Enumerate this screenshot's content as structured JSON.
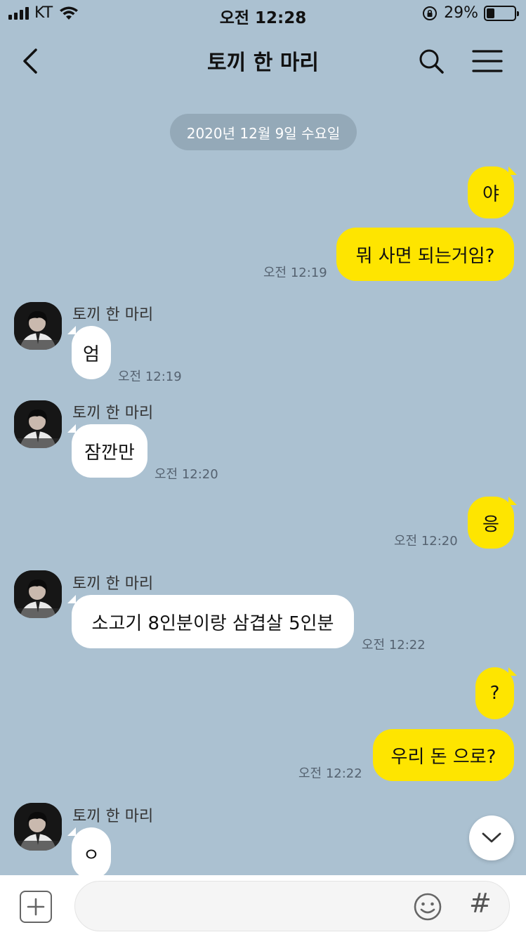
{
  "status_bar": {
    "carrier": "KT",
    "time": "오전 12:28",
    "battery": "29%",
    "battery_level": 0.29
  },
  "header": {
    "title": "토끼 한 마리",
    "back_icon": "chevron-left-icon",
    "search_icon": "search-icon",
    "menu_icon": "hamburger-menu-icon"
  },
  "date_divider": "2020년 12월 9일 수요일",
  "contact_name": "토끼 한 마리",
  "messages": [
    {
      "from": "me",
      "text": "야",
      "time": ""
    },
    {
      "from": "me",
      "text": "뭐 사면 되는거임?",
      "time": "오전 12:19"
    },
    {
      "from": "them",
      "text": "엄",
      "time": "오전 12:19"
    },
    {
      "from": "them",
      "text": "잠깐만",
      "time": "오전 12:20"
    },
    {
      "from": "me",
      "text": "응",
      "time": "오전 12:20"
    },
    {
      "from": "them",
      "text": "소고기 8인분이랑 삼겹살 5인분",
      "time": "오전 12:22"
    },
    {
      "from": "me",
      "text": "?",
      "time": ""
    },
    {
      "from": "me",
      "text": "우리 돈 으로?",
      "time": "오전 12:22"
    },
    {
      "from": "them",
      "text": "ㅇ",
      "time": ""
    }
  ],
  "input": {
    "placeholder": "",
    "value": "",
    "hash_label": "#"
  },
  "colors": {
    "background": "#abc1d1",
    "my_bubble": "#fee500",
    "their_bubble": "#ffffff"
  }
}
